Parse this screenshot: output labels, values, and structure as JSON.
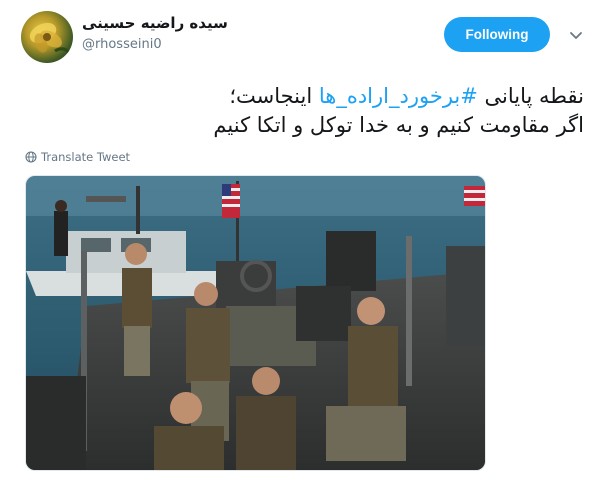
{
  "author": {
    "name": "سیده راضیه حسینی",
    "handle": "@rhosseini0"
  },
  "follow": {
    "label": "Following"
  },
  "tweet": {
    "line1_prefix": "نقطه پایانی ",
    "hashtag": "#برخورد_اراده_ها",
    "line1_suffix": " اینجاست؛",
    "line2": "اگر مقاومت کنیم و به خدا توکل و اتکا کنیم"
  },
  "translate": {
    "label": "Translate Tweet"
  },
  "colors": {
    "accent": "#1da1f2",
    "muted": "#657786",
    "text": "#14171a"
  },
  "icons": {
    "globe": "globe-icon",
    "caret": "chevron-down-icon"
  }
}
